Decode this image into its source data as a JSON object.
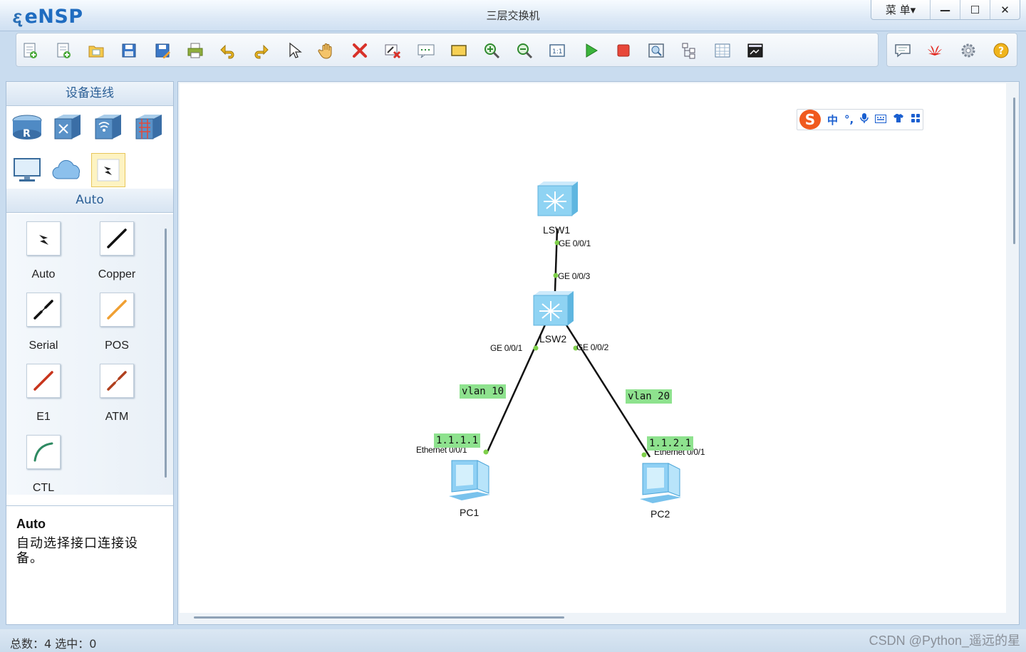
{
  "app": {
    "logo_text": "eNSP",
    "window_title": "三层交换机",
    "menu_label": "菜 单▾",
    "minimize": "—",
    "maximize": "☐",
    "close": "✕"
  },
  "toolbar": {
    "icons": [
      "new-topology",
      "new-topology-copy",
      "open",
      "save",
      "save-as",
      "print",
      "undo",
      "redo",
      "select",
      "pan-hand",
      "delete",
      "delete-all-links",
      "add-text",
      "add-rectangle",
      "zoom-in",
      "zoom-out",
      "fit-view",
      "start-device",
      "stop-device",
      "capture-data",
      "topology-tree",
      "grid",
      "console"
    ],
    "right_icons": [
      "message",
      "huawei",
      "settings",
      "help"
    ]
  },
  "left_panel": {
    "section_title": "设备连线",
    "device_categories": [
      "router",
      "switch",
      "wireless",
      "firewall",
      "pc",
      "cloud",
      "connection"
    ],
    "subsection_title": "Auto",
    "cables": [
      {
        "label": "Auto",
        "icon": "auto-cable",
        "color": "#222222"
      },
      {
        "label": "Copper",
        "icon": "copper-cable",
        "color": "#111111"
      },
      {
        "label": "Serial",
        "icon": "serial-cable",
        "color": "#111111"
      },
      {
        "label": "POS",
        "icon": "pos-cable",
        "color": "#f0a033"
      },
      {
        "label": "E1",
        "icon": "e1-cable",
        "color": "#c8341c"
      },
      {
        "label": "ATM",
        "icon": "atm-cable",
        "color": "#b0401e"
      },
      {
        "label": "CTL",
        "icon": "ctl-cable",
        "color": "#2e8a62"
      }
    ],
    "description": {
      "title": "Auto",
      "text": "自动选择接口连接设备。"
    }
  },
  "topology": {
    "devices": [
      {
        "name": "LSW1",
        "type": "switch"
      },
      {
        "name": "LSW2",
        "type": "switch"
      },
      {
        "name": "PC1",
        "type": "pc"
      },
      {
        "name": "PC2",
        "type": "pc"
      }
    ],
    "ports": {
      "lsw1_g1": "GE 0/0/1",
      "lsw2_g3": "GE 0/0/3",
      "lsw2_g1": "GE 0/0/1",
      "lsw2_g2": "GE 0/0/2",
      "pc1_eth": "Ethernet 0/0/1",
      "pc2_eth": "Ethernet 0/0/1"
    },
    "tags": {
      "vlan10": "vlan 10",
      "vlan20": "vlan 20",
      "pc1_ip": "1.1.1.1",
      "pc2_ip": "1.1.2.1"
    },
    "link_color": "#111111",
    "port_dot_color": "#7ed04a"
  },
  "ime": {
    "logo": "S",
    "mode": "中",
    "punct": "°,"
  },
  "status": {
    "text": "总数：4  选中：0",
    "watermark": "CSDN @Python_遥远的星"
  }
}
